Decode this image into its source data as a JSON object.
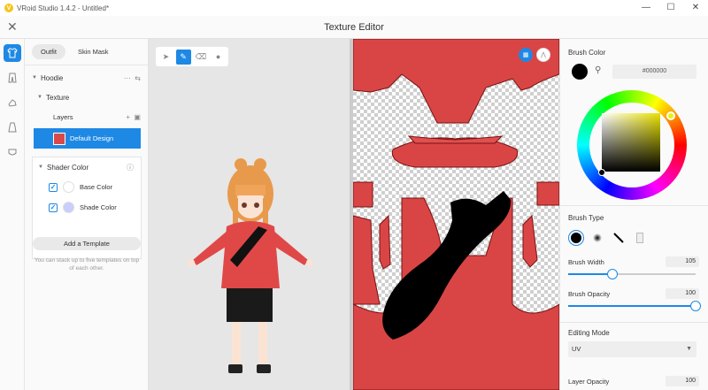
{
  "window": {
    "title": "VRoid Studio 1.4.2 - Untitled*",
    "controls": [
      "—",
      "☐",
      "✕"
    ]
  },
  "header": {
    "title": "Texture Editor",
    "close_label": "✕"
  },
  "left_panel": {
    "tabs": [
      {
        "label": "Outfit",
        "active": true
      },
      {
        "label": "Skin Mask",
        "active": false
      }
    ],
    "item": "Hoodie",
    "texture_section": "Texture",
    "layers_label": "Layers",
    "layer_name": "Default Design",
    "shader_section": "Shader Color",
    "shader_rows": [
      {
        "label": "Base Color",
        "checked": true,
        "swatch": "#ffffff"
      },
      {
        "label": "Shade Color",
        "checked": true,
        "swatch": "#c9cffd"
      }
    ],
    "add_template": "Add a Template",
    "template_note": "You can stack up to five templates on top of each other."
  },
  "right_panel": {
    "brush_color_title": "Brush Color",
    "hex_value": "#000000",
    "brush_type_title": "Brush Type",
    "brush_width_label": "Brush Width",
    "brush_width_value": "105",
    "brush_width_fraction": 0.35,
    "brush_opacity_label": "Brush Opacity",
    "brush_opacity_value": "100",
    "brush_opacity_fraction": 1.0,
    "editing_mode_title": "Editing Mode",
    "editing_mode_value": "UV",
    "layer_opacity_label": "Layer Opacity",
    "layer_opacity_value": "100"
  },
  "colors": {
    "accent": "#1e88e5",
    "uv_red": "#d94545",
    "brush": "#000000"
  }
}
